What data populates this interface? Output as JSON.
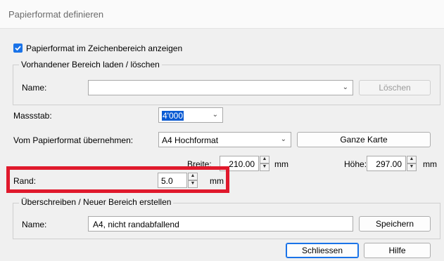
{
  "window": {
    "title": "Papierformat definieren"
  },
  "show_in_drawing": {
    "label": "Papierformat im Zeichenbereich anzeigen",
    "checked": true
  },
  "existing_area": {
    "legend": "Vorhandener Bereich laden / löschen",
    "name_label": "Name:",
    "name_value": "",
    "delete_button": "Löschen"
  },
  "scale": {
    "label": "Massstab:",
    "value": "4'000"
  },
  "paper_format": {
    "label": "Vom Papierformat übernehmen:",
    "value": "A4 Hochformat",
    "whole_map_button": "Ganze Karte"
  },
  "size": {
    "width_label": "Breite:",
    "width_value": "210.00",
    "width_unit": "mm",
    "height_label": "Höhe:",
    "height_value": "297.00",
    "height_unit": "mm"
  },
  "margin": {
    "label": "Rand:",
    "value": "5.0",
    "unit": "mm"
  },
  "new_area": {
    "legend": "Überschreiben / Neuer Bereich erstellen",
    "name_label": "Name:",
    "name_value": "A4, nicht randabfallend",
    "save_button": "Speichern"
  },
  "footer": {
    "close_button": "Schliessen",
    "help_button": "Hilfe"
  },
  "colors": {
    "highlight": "#e0192c",
    "accent": "#1a73e8"
  }
}
